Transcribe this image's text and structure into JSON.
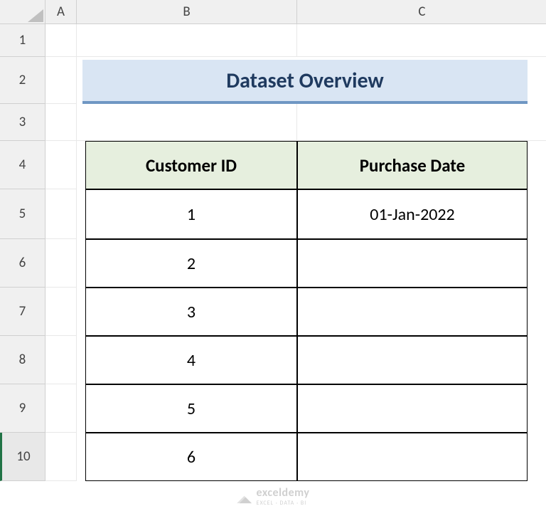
{
  "columns": [
    "A",
    "B",
    "C"
  ],
  "rows": [
    "1",
    "2",
    "3",
    "4",
    "5",
    "6",
    "7",
    "8",
    "9",
    "10"
  ],
  "title": "Dataset Overview",
  "table": {
    "headers": {
      "col_b": "Customer ID",
      "col_c": "Purchase Date"
    },
    "data": [
      {
        "id": "1",
        "date": "01-Jan-2022"
      },
      {
        "id": "2",
        "date": ""
      },
      {
        "id": "3",
        "date": ""
      },
      {
        "id": "4",
        "date": ""
      },
      {
        "id": "5",
        "date": ""
      },
      {
        "id": "6",
        "date": ""
      }
    ]
  },
  "watermark": {
    "main": "exceldemy",
    "sub": "EXCEL · DATA · BI"
  }
}
